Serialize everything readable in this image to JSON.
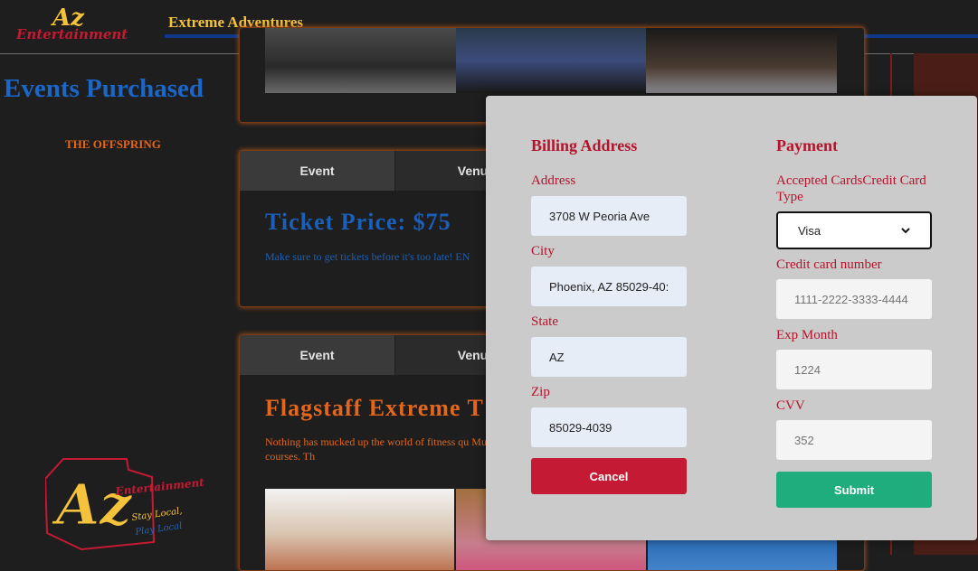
{
  "header": {
    "logo_text": "Az Entertainment",
    "site_title": "Extreme Adventures"
  },
  "sidebar": {
    "title": "Events Purchased",
    "items": [
      {
        "label": "THE OFFSPRING"
      }
    ],
    "bottom_logo_text": "Az Entertainment Stay Local, Play Local"
  },
  "cards": [
    {
      "tabs": [
        "Event",
        "Venu"
      ],
      "heading": "Ticket Price: $75",
      "description": "Make sure to get tickets before it's too late! EN"
    },
    {
      "tabs": [
        "Event",
        "Venu"
      ],
      "heading": "Flagstaff Extreme T",
      "description": "Nothing has mucked up the world of fitness qu Mudder, Rugged Mudder, and Spartan Race ha Flagstaff this year - 5k, 10k, or 20k courses. Th"
    }
  ],
  "modal": {
    "billing": {
      "title": "Billing Address",
      "address_label": "Address",
      "address_value": "3708 W Peoria Ave",
      "city_label": "City",
      "city_value": "Phoenix, AZ 85029-40:",
      "state_label": "State",
      "state_value": "AZ",
      "zip_label": "Zip",
      "zip_value": "85029-4039",
      "cancel_label": "Cancel"
    },
    "payment": {
      "title": "Payment",
      "card_type_label": "Accepted CardsCredit Card Type",
      "card_type_value": "Visa",
      "card_number_label": "Credit card number",
      "card_number_placeholder": "1111-2222-3333-4444",
      "exp_month_label": "Exp Month",
      "exp_month_placeholder": "1224",
      "cvv_label": "CVV",
      "cvv_placeholder": "352",
      "submit_label": "Submit"
    }
  },
  "colors": {
    "accent_red": "#c41a34",
    "accent_green": "#1fad7d",
    "brand_yellow": "#f5c33b",
    "brand_blue": "#1b66c9",
    "orange": "#e4661d"
  }
}
